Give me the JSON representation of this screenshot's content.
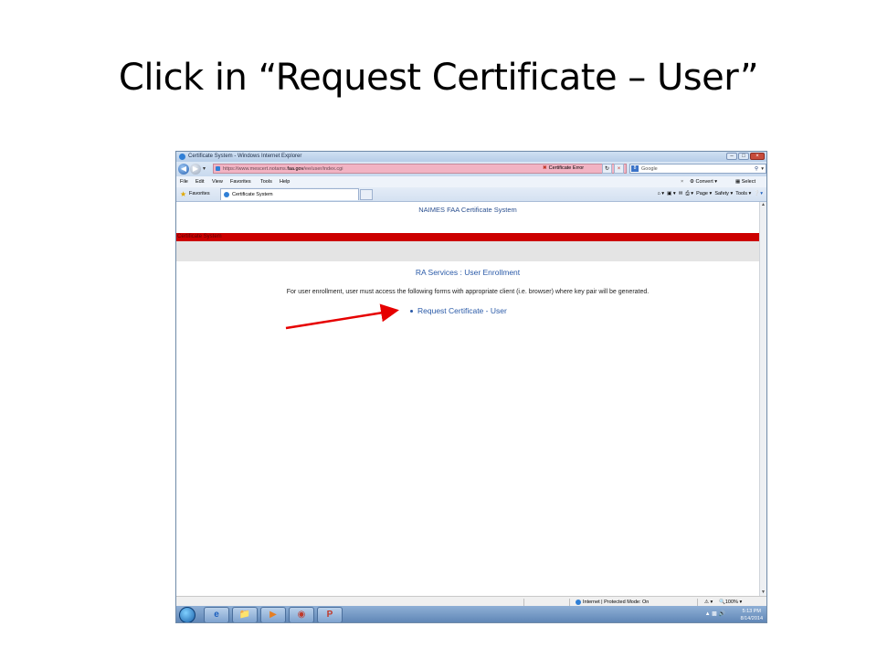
{
  "slide": {
    "title": "Click in “Request Certificate – User”"
  },
  "browser": {
    "window_title": "Certificate System - Windows Internet Explorer",
    "address": {
      "prefix": "https://www.mescert.notams.",
      "host": "faa.gov",
      "path": "/ee/user/index.cgi"
    },
    "cert_error": "Certificate Error",
    "search_placeholder": "Google",
    "menu": [
      "File",
      "Edit",
      "View",
      "Favorites",
      "Tools",
      "Help"
    ],
    "convert_label": "Convert",
    "select_label": "Select",
    "favorites_label": "Favorites",
    "tab_title": "Certificate System",
    "commandbar": {
      "page": "Page ▾",
      "safety": "Safety ▾",
      "tools": "Tools ▾"
    }
  },
  "page": {
    "site_name": "NAIMES FAA Certificate System",
    "redbar_label": "Certificate System",
    "heading": "RA Services : User Enrollment",
    "description": "For user enrollment, user must access the following forms with appropriate client (i.e. browser) where key pair will be generated.",
    "link": "Request Certificate - User"
  },
  "statusbar": {
    "zone": "Internet | Protected Mode: On",
    "zoom": "100%"
  },
  "taskbar": {
    "time": "5:13 PM",
    "date": "8/14/2014"
  },
  "colors": {
    "redbar": "#cc0000",
    "link": "#2a5aa8",
    "arrow": "#e60000",
    "address_error": "#f2b3c3"
  },
  "icons": [
    "windows-start-icon",
    "ie-icon",
    "folder-icon",
    "media-player-icon",
    "chrome-icon",
    "powerpoint-icon",
    "globe-icon",
    "search-icon",
    "star-icon"
  ]
}
